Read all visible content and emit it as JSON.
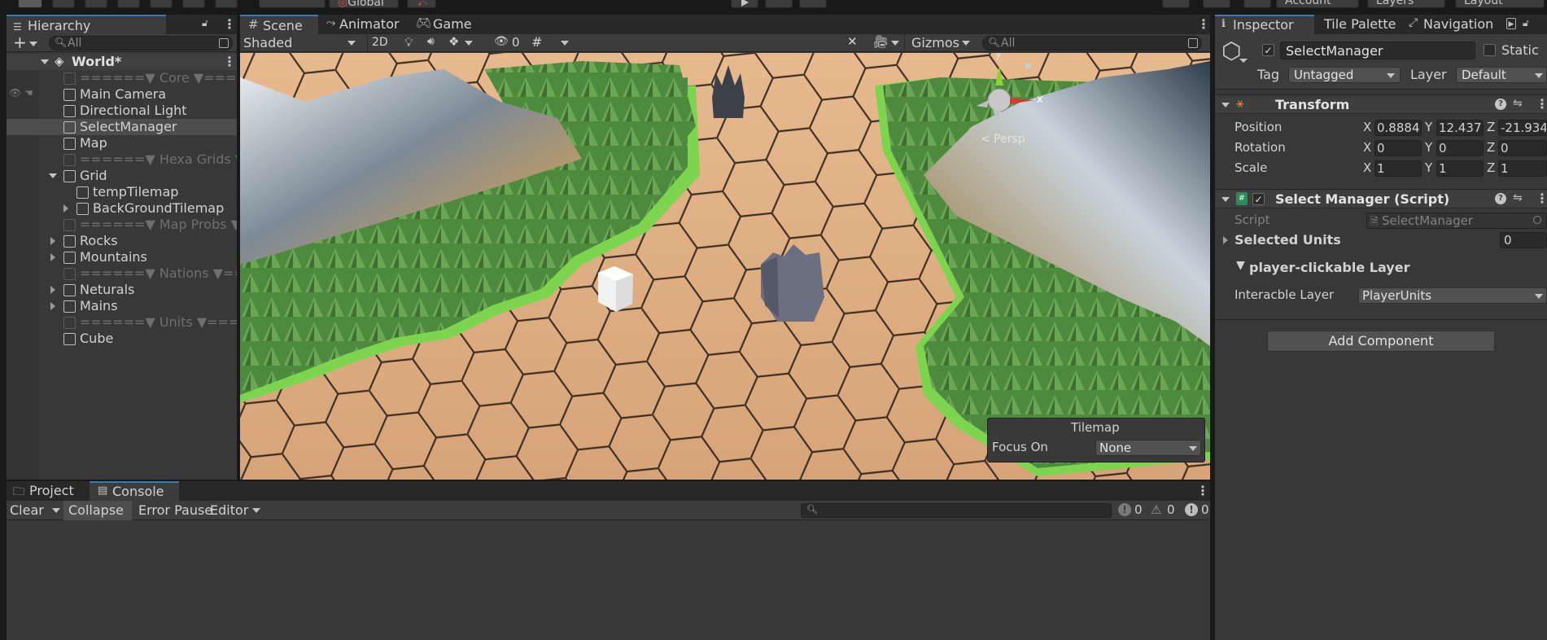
{
  "topbar": {
    "pivot": "Global",
    "account": "Account",
    "layers": "Layers",
    "layout": "Layout"
  },
  "hierarchy": {
    "tab": "Hierarchy",
    "search_placeholder": "All",
    "scene": "World*",
    "items": [
      {
        "label": "======▼ Core ▼===",
        "dim": true,
        "indent": 0
      },
      {
        "label": "Main Camera",
        "indent": 0
      },
      {
        "label": "Directional Light",
        "indent": 0
      },
      {
        "label": "SelectManager",
        "indent": 0,
        "selected": true
      },
      {
        "label": "Map",
        "indent": 0
      },
      {
        "label": "======▼ Hexa Grids ▼",
        "dim": true,
        "indent": 0
      },
      {
        "label": "Grid",
        "indent": 0,
        "expanded": true
      },
      {
        "label": "tempTilemap",
        "indent": 1
      },
      {
        "label": "BackGroundTilemap",
        "indent": 1,
        "collapsed": true
      },
      {
        "label": "======▼ Map Probs ▼",
        "dim": true,
        "indent": 0
      },
      {
        "label": "Rocks",
        "indent": 0,
        "collapsed": true
      },
      {
        "label": "Mountains",
        "indent": 0,
        "collapsed": true
      },
      {
        "label": "======▼ Nations ▼==",
        "dim": true,
        "indent": 0
      },
      {
        "label": "Neturals",
        "indent": 0,
        "collapsed": true
      },
      {
        "label": "Mains",
        "indent": 0,
        "collapsed": true
      },
      {
        "label": "======▼ Units ▼===",
        "dim": true,
        "indent": 0
      },
      {
        "label": "Cube",
        "indent": 0
      }
    ]
  },
  "scene_view": {
    "tabs": [
      "Scene",
      "Animator",
      "Game"
    ],
    "shading": "Shaded",
    "mode_2d": "2D",
    "hidden_count": "0",
    "gizmos": "Gizmos",
    "search_placeholder": "All",
    "persp": "< Persp",
    "axis_y": "y",
    "axis_x": "x",
    "overlay": {
      "title": "Tilemap",
      "focus_label": "Focus On",
      "focus_value": "None"
    }
  },
  "console": {
    "tabs": [
      "Project",
      "Console"
    ],
    "clear": "Clear",
    "collapse": "Collapse",
    "error_pause": "Error Pause",
    "editor": "Editor",
    "counts": {
      "log": "0",
      "warn": "0",
      "error": "0"
    }
  },
  "inspector": {
    "tabs": [
      "Inspector",
      "Tile Palette",
      "Navigation"
    ],
    "object_name": "SelectManager",
    "static_label": "Static",
    "tag_label": "Tag",
    "tag_value": "Untagged",
    "layer_label": "Layer",
    "layer_value": "Default",
    "transform": {
      "title": "Transform",
      "rows": [
        {
          "label": "Position",
          "x": "0.8884",
          "y": "12.437",
          "z": "-21.934"
        },
        {
          "label": "Rotation",
          "x": "0",
          "y": "0",
          "z": "0"
        },
        {
          "label": "Scale",
          "x": "1",
          "y": "1",
          "z": "1"
        }
      ],
      "x": "X",
      "y": "Y",
      "z": "Z"
    },
    "script_component": {
      "title": "Select Manager (Script)",
      "script_label": "Script",
      "script_value": "SelectManager",
      "selected_units_label": "Selected Units",
      "selected_units_value": "0",
      "layer_header": "player-clickable Layer",
      "interactable_label": "Interacble Layer",
      "interactable_value": "PlayerUnits"
    },
    "add_component": "Add Component"
  },
  "colors": {
    "panel": "#383838",
    "dark": "#282828",
    "selected": "#4d4d4d",
    "accent": "#3a79bb",
    "sand": "#d8a77b",
    "grass": "#7cc74d"
  }
}
